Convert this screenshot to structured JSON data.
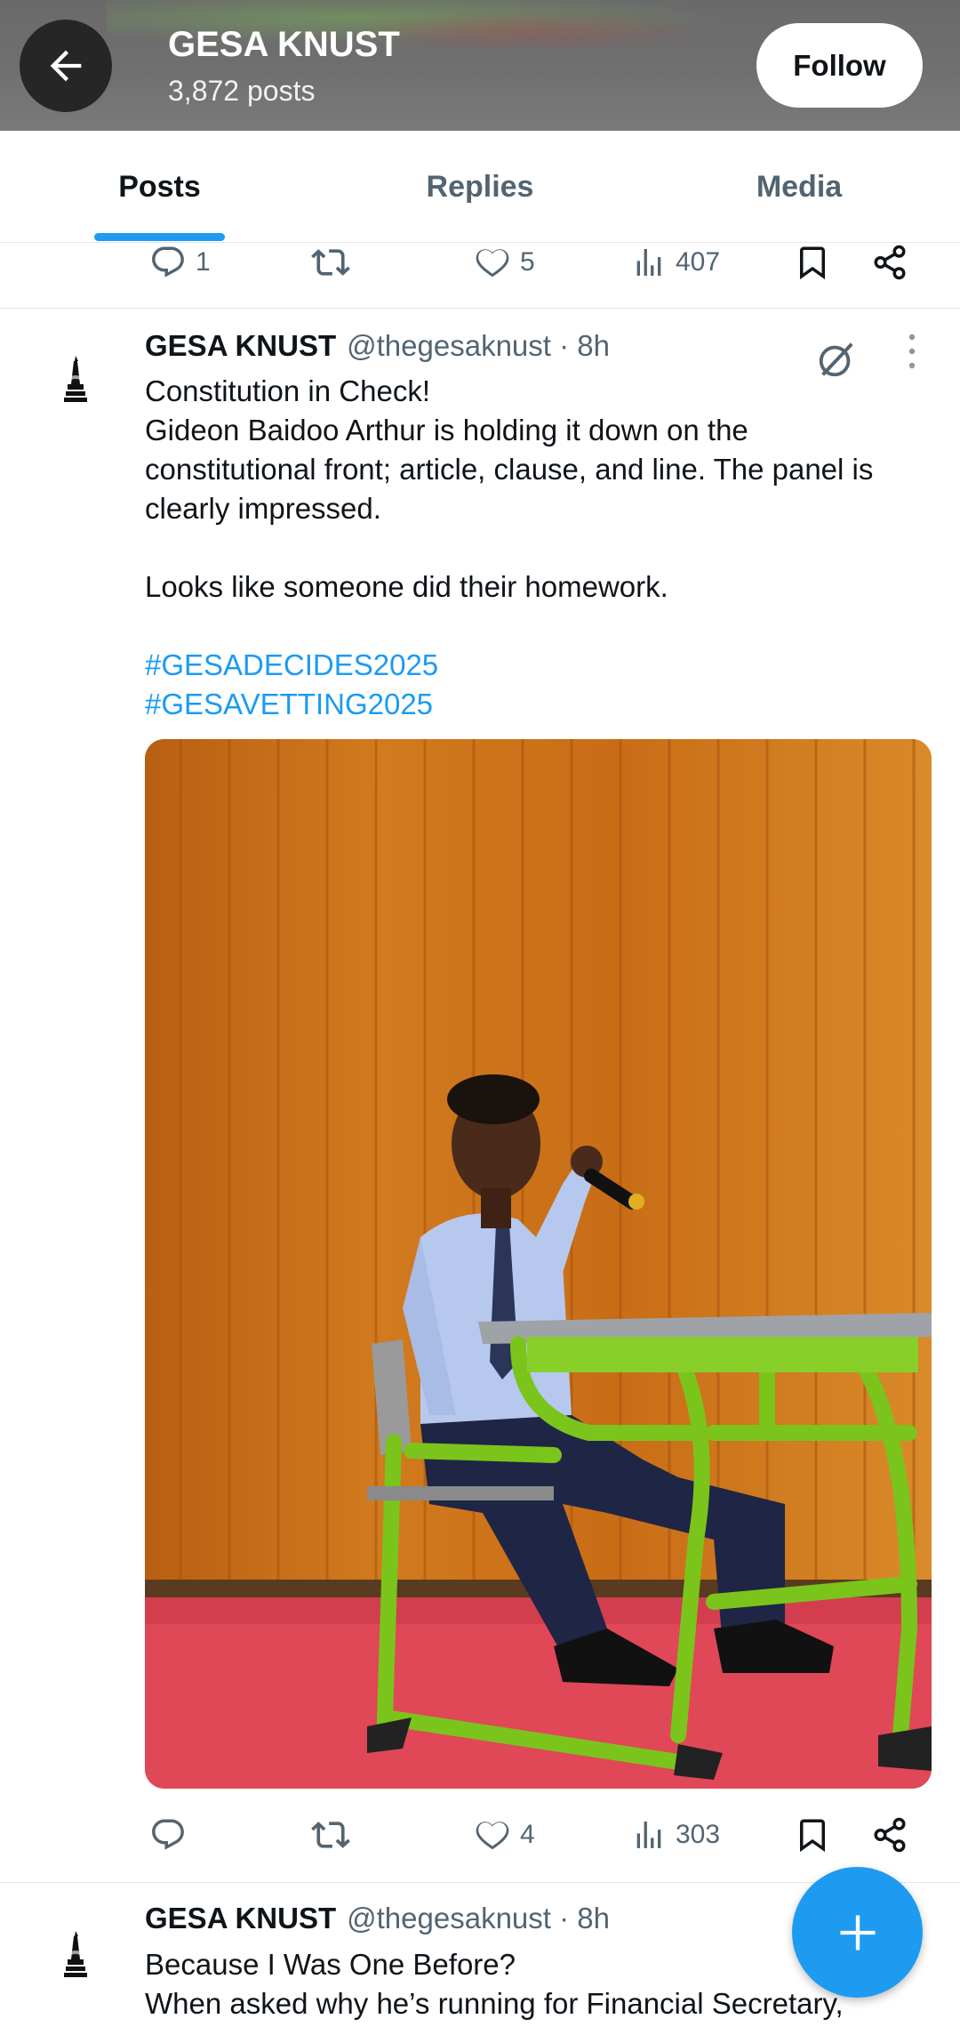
{
  "header": {
    "title": "GESA KNUST",
    "post_count": "3,872 posts",
    "follow_label": "Follow"
  },
  "tabs": [
    {
      "label": "Posts",
      "active": true
    },
    {
      "label": "Replies",
      "active": false
    },
    {
      "label": "Media",
      "active": false
    }
  ],
  "prev_post_actions": {
    "replies": "1",
    "retweets": "",
    "likes": "5",
    "views": "407"
  },
  "post1": {
    "name": "GESA KNUST",
    "handle": "@thegesaknust · 8h",
    "lines": [
      "Constitution in Check!",
      "Gideon Baidoo Arthur is holding it down on the",
      "constitutional front; article, clause, and line. The panel is",
      "clearly impressed.",
      "",
      "Looks like someone did their homework.",
      ""
    ],
    "hashtags": [
      "#GESADECIDES2025",
      "#GESAVETTING2025"
    ],
    "actions": {
      "replies": "",
      "retweets": "",
      "likes": "4",
      "views": "303"
    }
  },
  "post2": {
    "name": "GESA KNUST",
    "handle": "@thegesaknust · 8h",
    "lines": [
      "Because I Was One Before?",
      "When asked why he’s running for Financial Secretary,"
    ]
  },
  "colors": {
    "accent": "#1d9bf0",
    "text": "#0f1419",
    "muted": "#536471"
  },
  "icons": [
    "back-arrow-icon",
    "reply-icon",
    "retweet-icon",
    "like-icon",
    "views-icon",
    "bookmark-icon",
    "share-icon",
    "grok-icon",
    "more-icon",
    "compose-plus-icon"
  ]
}
